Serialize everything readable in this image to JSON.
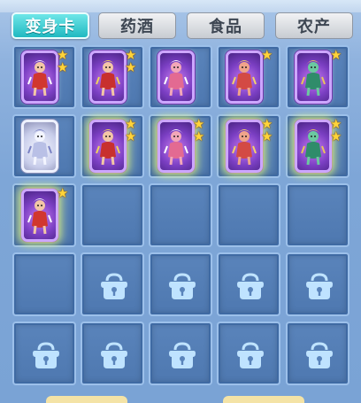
{
  "tabs": [
    {
      "label": "变身卡",
      "active": true
    },
    {
      "label": "药酒",
      "active": false
    },
    {
      "label": "食品",
      "active": false
    },
    {
      "label": "农产",
      "active": false
    }
  ],
  "grid": {
    "columns": 5,
    "rows": [
      [
        {
          "type": "card",
          "variant": "purple",
          "character": "red-white warrior",
          "stars": 2,
          "glow": false
        },
        {
          "type": "card",
          "variant": "purple",
          "character": "red warrior",
          "stars": 2,
          "glow": false
        },
        {
          "type": "card",
          "variant": "purple",
          "character": "pink ogre",
          "stars": 0,
          "glow": false
        },
        {
          "type": "card",
          "variant": "purple",
          "character": "red ogre",
          "stars": 1,
          "glow": false
        },
        {
          "type": "card",
          "variant": "purple",
          "character": "green dragon",
          "stars": 1,
          "glow": false
        }
      ],
      [
        {
          "type": "card",
          "variant": "silver",
          "character": "white knight",
          "stars": 0,
          "glow": false
        },
        {
          "type": "card",
          "variant": "purple",
          "character": "monkey king",
          "stars": 2,
          "glow": true
        },
        {
          "type": "card",
          "variant": "purple",
          "character": "white-haired sage",
          "stars": 2,
          "glow": true
        },
        {
          "type": "card",
          "variant": "purple",
          "character": "phoenix bird",
          "stars": 2,
          "glow": true
        },
        {
          "type": "card",
          "variant": "purple",
          "character": "horned warrior",
          "stars": 2,
          "glow": true
        }
      ],
      [
        {
          "type": "card",
          "variant": "purple",
          "character": "dragon",
          "stars": 1,
          "glow": true
        },
        {
          "type": "empty"
        },
        {
          "type": "empty"
        },
        {
          "type": "empty"
        },
        {
          "type": "empty"
        }
      ],
      [
        {
          "type": "empty"
        },
        {
          "type": "locked"
        },
        {
          "type": "locked"
        },
        {
          "type": "locked"
        },
        {
          "type": "locked"
        }
      ],
      [
        {
          "type": "locked"
        },
        {
          "type": "locked"
        },
        {
          "type": "locked"
        },
        {
          "type": "locked"
        },
        {
          "type": "locked"
        }
      ]
    ]
  },
  "colors": {
    "active_tab": "#20b9c1",
    "slot_bg": "#5a84bb",
    "lock": "#bfe3ff",
    "star": "#ffd43a",
    "card_frame": "#cda6ff"
  }
}
